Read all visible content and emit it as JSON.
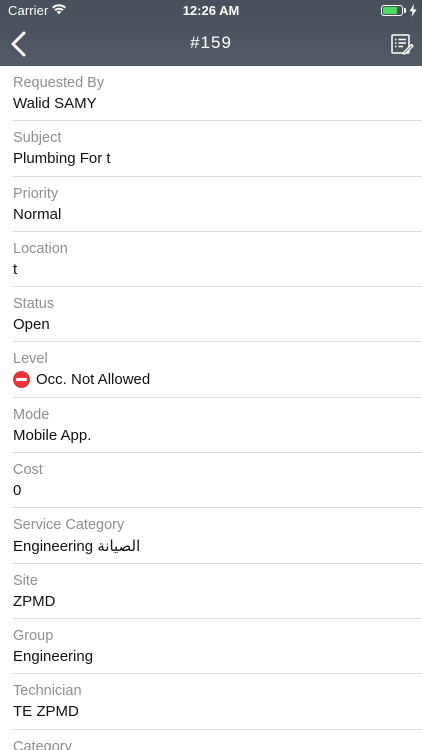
{
  "status_bar": {
    "carrier": "Carrier",
    "time": "12:26 AM",
    "battery_level": 0.75,
    "battery_color": "#4cd964"
  },
  "nav": {
    "title": "#159",
    "back_icon": "chevron-left-icon",
    "action_icon": "notes-icon",
    "background": "#4c545f"
  },
  "fields": [
    {
      "label": "Requested By",
      "value": "Walid SAMY"
    },
    {
      "label": "Subject",
      "value": "Plumbing For t"
    },
    {
      "label": "Priority",
      "value": "Normal"
    },
    {
      "label": "Location",
      "value": "t"
    },
    {
      "label": "Status",
      "value": "Open"
    },
    {
      "label": "Level",
      "value": "Occ. Not Allowed",
      "icon": "no-entry-icon"
    },
    {
      "label": "Mode",
      "value": "Mobile App."
    },
    {
      "label": "Cost",
      "value": "0"
    },
    {
      "label": "Service Category",
      "value": "Engineering الصيانة"
    },
    {
      "label": "Site",
      "value": "ZPMD"
    },
    {
      "label": "Group",
      "value": "Engineering"
    },
    {
      "label": "Technician",
      "value": "TE ZPMD"
    },
    {
      "label": "Category",
      "value": ""
    }
  ]
}
